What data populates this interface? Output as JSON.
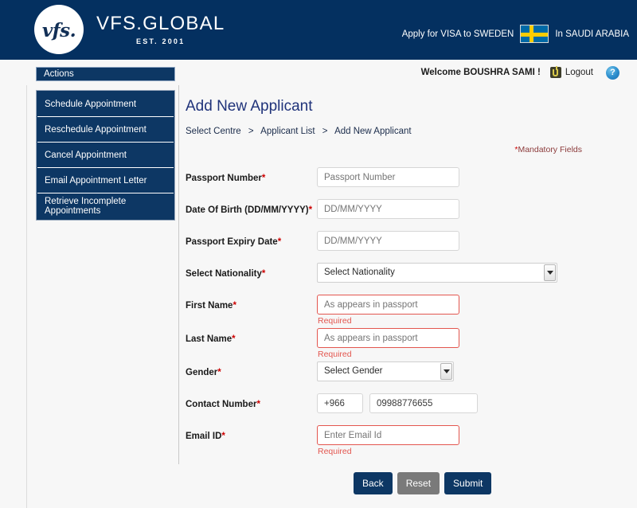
{
  "header": {
    "logo_mark": "vfs.",
    "brand_name": "VFS.GLOBAL",
    "brand_est": "EST. 2001",
    "apply_prefix": "Apply for VISA to SWEDEN",
    "apply_suffix": "In SAUDI ARABIA",
    "flag_country": "Sweden",
    "navy": "#043060"
  },
  "welcome": {
    "text": "Welcome BOUSHRA SAMI !",
    "logout_label": "Logout",
    "logout_icon": "power-icon",
    "help_icon": "help-question-icon"
  },
  "sidebar": {
    "title": "Actions",
    "items": [
      {
        "label": "Schedule Appointment"
      },
      {
        "label": "Reschedule Appointment"
      },
      {
        "label": "Cancel Appointment"
      },
      {
        "label": "Email Appointment Letter"
      },
      {
        "label": "Retrieve Incomplete Appointments"
      }
    ]
  },
  "main": {
    "page_title": "Add New Applicant",
    "breadcrumb": [
      {
        "label": "Select Centre"
      },
      {
        "label": "Applicant List"
      },
      {
        "label": "Add New Applicant"
      }
    ],
    "breadcrumb_separator": ">",
    "mandatory_star": "*",
    "mandatory_note": "Mandatory Fields"
  },
  "form": {
    "passport_number": {
      "label": "Passport Number",
      "star": "*",
      "placeholder": "Passport Number",
      "value": ""
    },
    "date_of_birth": {
      "label": "Date Of Birth (DD/MM/YYYY)",
      "star": "*",
      "placeholder": "DD/MM/YYYY",
      "value": ""
    },
    "passport_expiry": {
      "label": "Passport Expiry Date",
      "star": "*",
      "placeholder": "DD/MM/YYYY",
      "value": ""
    },
    "nationality": {
      "label": "Select Nationality",
      "star": "*",
      "selected": "Select Nationality"
    },
    "first_name": {
      "label": "First Name",
      "star": "*",
      "placeholder": "As appears in passport",
      "value": "",
      "error": "Required"
    },
    "last_name": {
      "label": "Last Name",
      "star": "*",
      "placeholder": "As appears in passport",
      "value": "",
      "error": "Required"
    },
    "gender": {
      "label": "Gender",
      "star": "*",
      "selected": "Select Gender"
    },
    "contact_number": {
      "label": "Contact Number",
      "star": "*",
      "country_code": "+966",
      "value": "09988776655"
    },
    "email": {
      "label": "Email ID",
      "star": "*",
      "placeholder": "Enter Email Id",
      "value": "",
      "error": "Required"
    }
  },
  "buttons": {
    "back": "Back",
    "reset": "Reset",
    "submit": "Submit",
    "navy": "#0d3764",
    "gray": "#7a7a7a",
    "error_red": "#e3564f"
  }
}
